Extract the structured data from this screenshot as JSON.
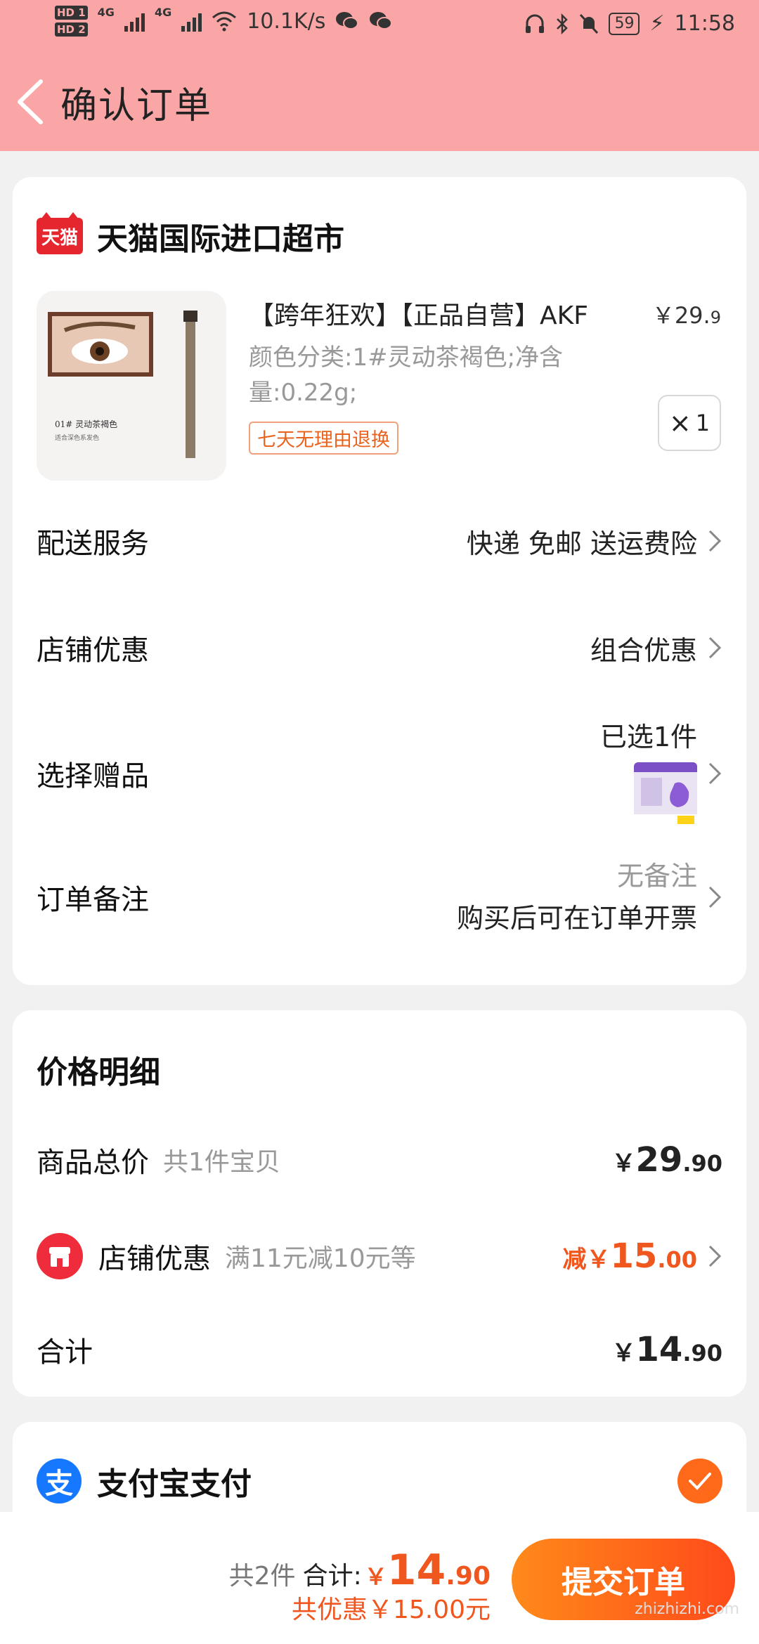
{
  "status_bar": {
    "hd1": "HD 1",
    "hd2": "HD 2",
    "net1": "4G",
    "net2": "4G",
    "speed": "10.1K/s",
    "battery": "59",
    "time": "11:58"
  },
  "header": {
    "title": "确认订单"
  },
  "shop": {
    "badge": "天猫",
    "name": "天猫国际进口超市"
  },
  "product": {
    "title": "【跨年狂欢】【正品自营】AKF",
    "price_main": "￥29.",
    "price_dec": "9",
    "spec": "颜色分类:1#灵动茶褐色;净含量:0.22g;",
    "return_tag": "七天无理由退换",
    "qty": "1",
    "thumb_text1": "01# 灵动茶褐色",
    "thumb_text2": "适合深色系发色"
  },
  "rows": {
    "delivery_label": "配送服务",
    "delivery_value": "快递 免邮 送运费险",
    "shop_discount_label": "店铺优惠",
    "shop_discount_value": "组合优惠",
    "gift_label": "选择赠品",
    "gift_value": "已选1件",
    "remark_label": "订单备注",
    "remark_value": "无备注",
    "invoice_note": "购买后可在订单开票"
  },
  "price_detail": {
    "title": "价格明细",
    "total_label": "商品总价",
    "total_sub": "共1件宝贝",
    "total_cur": "￥",
    "total_int": "29",
    "total_dec": ".90",
    "discount_label": "店铺优惠",
    "discount_sub": "满11元减10元等",
    "discount_prefix": "减￥",
    "discount_int": "15",
    "discount_dec": ".00",
    "sum_label": "合计",
    "sum_cur": "￥",
    "sum_int": "14",
    "sum_dec": ".90"
  },
  "payment": {
    "icon": "支",
    "name": "支付宝支付"
  },
  "bottom": {
    "count": "共2件",
    "total_label": "合计:",
    "cur": "￥",
    "amount_int": "14",
    "amount_dec": ".90",
    "saved": "共优惠￥15.00元",
    "submit": "提交订单",
    "watermark": "zhizhizhi.com"
  },
  "colors": {
    "header_bg": "#fba6a6",
    "accent": "#f0571e",
    "tmall_red": "#e5262e",
    "alipay_blue": "#1677ff"
  }
}
